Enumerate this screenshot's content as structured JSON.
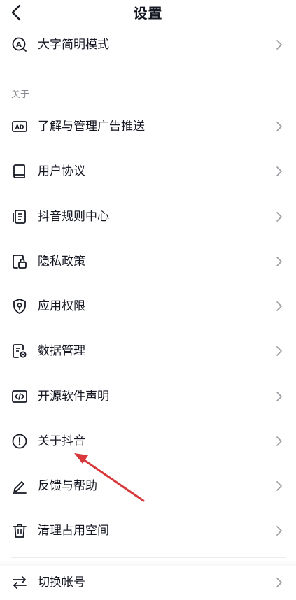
{
  "header": {
    "title": "设置"
  },
  "top_item": {
    "label": "大字简明模式"
  },
  "about_section": {
    "title": "关于",
    "items": [
      {
        "label": "了解与管理广告推送",
        "icon": "ad-icon"
      },
      {
        "label": "用户协议",
        "icon": "book-icon"
      },
      {
        "label": "抖音规则中心",
        "icon": "rules-document-icon"
      },
      {
        "label": "隐私政策",
        "icon": "privacy-lock-icon"
      },
      {
        "label": "应用权限",
        "icon": "permission-shield-icon"
      },
      {
        "label": "数据管理",
        "icon": "data-manage-icon"
      },
      {
        "label": "开源软件声明",
        "icon": "code-icon"
      },
      {
        "label": "关于抖音",
        "icon": "info-circle-icon"
      },
      {
        "label": "反馈与帮助",
        "icon": "pencil-icon"
      },
      {
        "label": "清理占用空间",
        "icon": "trash-icon"
      }
    ]
  },
  "account_item": {
    "label": "切换帐号",
    "icon": "switch-arrows-icon"
  },
  "colors": {
    "annotation_arrow": "#d9383a",
    "text": "#161823",
    "muted": "#8a8b91"
  }
}
